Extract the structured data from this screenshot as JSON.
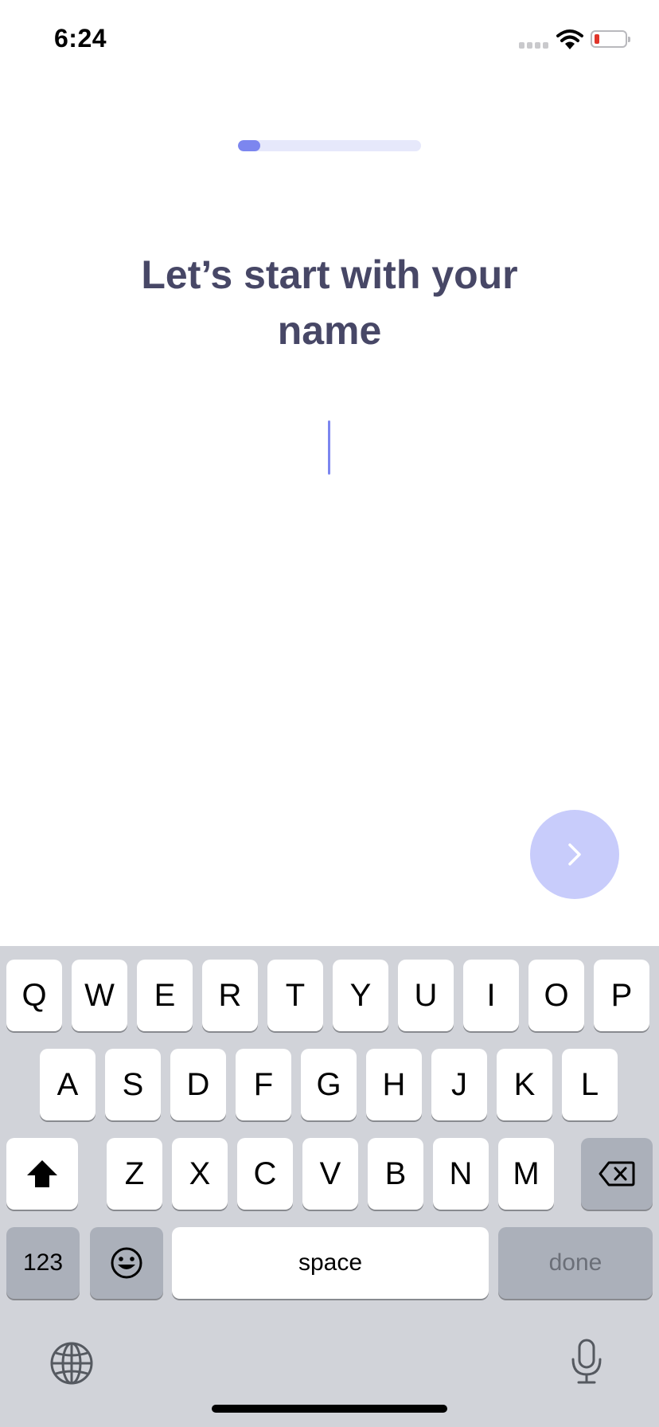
{
  "status_bar": {
    "time": "6:24"
  },
  "progress": {
    "fraction": 0.12
  },
  "title": "Let’s start with your name",
  "name_input": {
    "value": "",
    "placeholder": ""
  },
  "colors": {
    "accent": "#7c86ef",
    "title": "#474766",
    "next_button": "#c8ccfb",
    "keyboard_bg": "#d1d3d9"
  },
  "keyboard": {
    "row1": [
      "Q",
      "W",
      "E",
      "R",
      "T",
      "Y",
      "U",
      "I",
      "O",
      "P"
    ],
    "row2": [
      "A",
      "S",
      "D",
      "F",
      "G",
      "H",
      "J",
      "K",
      "L"
    ],
    "row3": [
      "Z",
      "X",
      "C",
      "V",
      "B",
      "N",
      "M"
    ],
    "numbers_label": "123",
    "space_label": "space",
    "done_label": "done",
    "icons": [
      "shift-icon",
      "delete-icon",
      "emoji-icon",
      "globe-icon",
      "microphone-icon"
    ]
  }
}
